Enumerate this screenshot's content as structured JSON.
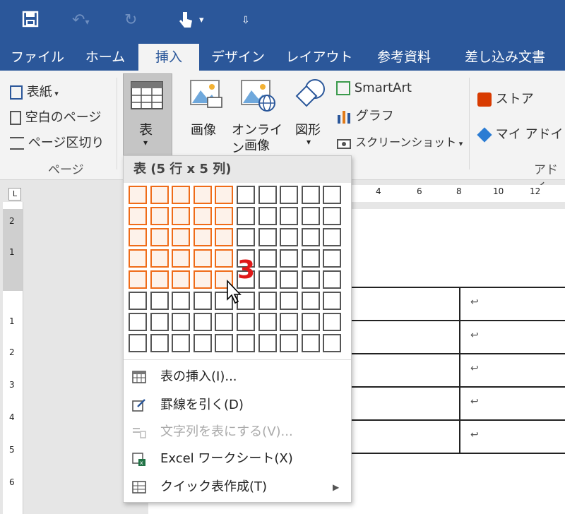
{
  "quick_access": {
    "items": [
      "save-icon",
      "undo-icon",
      "redo-icon",
      "touch-mode-icon",
      "customize-icon"
    ]
  },
  "tabs": [
    {
      "label": "ファイル",
      "active": false
    },
    {
      "label": "ホーム",
      "active": false
    },
    {
      "label": "挿入",
      "active": true
    },
    {
      "label": "デザイン",
      "active": false
    },
    {
      "label": "レイアウト",
      "active": false
    },
    {
      "label": "参考資料",
      "active": false
    },
    {
      "label": "差し込み文書",
      "active": false
    }
  ],
  "ribbon": {
    "page_group": {
      "cover": "表紙",
      "blank": "空白のページ",
      "break": "ページ区切り",
      "label": "ページ"
    },
    "table_button": "表",
    "picture": "画像",
    "online_picture_1": "オンライン",
    "online_picture_2": "画像",
    "shapes": "図形",
    "smartart": "SmartArt",
    "chart": "グラフ",
    "screenshot": "スクリーンショット",
    "store": "ストア",
    "my_addins": "マイ アドイン",
    "addins_label": "アドイ"
  },
  "dropdown": {
    "title": "表 (5 行 x 5 列)",
    "grid": {
      "cols": 10,
      "rows": 8,
      "selected_cols": 5,
      "selected_rows": 5
    },
    "menu": [
      {
        "label": "表の挿入(I)...",
        "icon": "insert-table-icon",
        "disabled": false
      },
      {
        "label": "罫線を引く(D)",
        "icon": "draw-table-icon",
        "disabled": false
      },
      {
        "label": "文字列を表にする(V)...",
        "icon": "text-to-table-icon",
        "disabled": true
      },
      {
        "label": "Excel ワークシート(X)",
        "icon": "excel-icon",
        "disabled": false
      },
      {
        "label": "クイック表作成(T)",
        "icon": "quick-table-icon",
        "disabled": false,
        "submenu": true
      }
    ]
  },
  "annotation": "3",
  "ruler": {
    "h_ticks": [
      "4",
      "6",
      "8",
      "10",
      "12"
    ],
    "v_ticks": [
      "2",
      "1",
      "1",
      "2",
      "3",
      "4",
      "5",
      "6"
    ]
  },
  "table_cell_marker": "↩",
  "colors": {
    "ribbon_blue": "#2b579a",
    "selection_orange": "#ef6c19",
    "annotation_red": "#e01818"
  }
}
